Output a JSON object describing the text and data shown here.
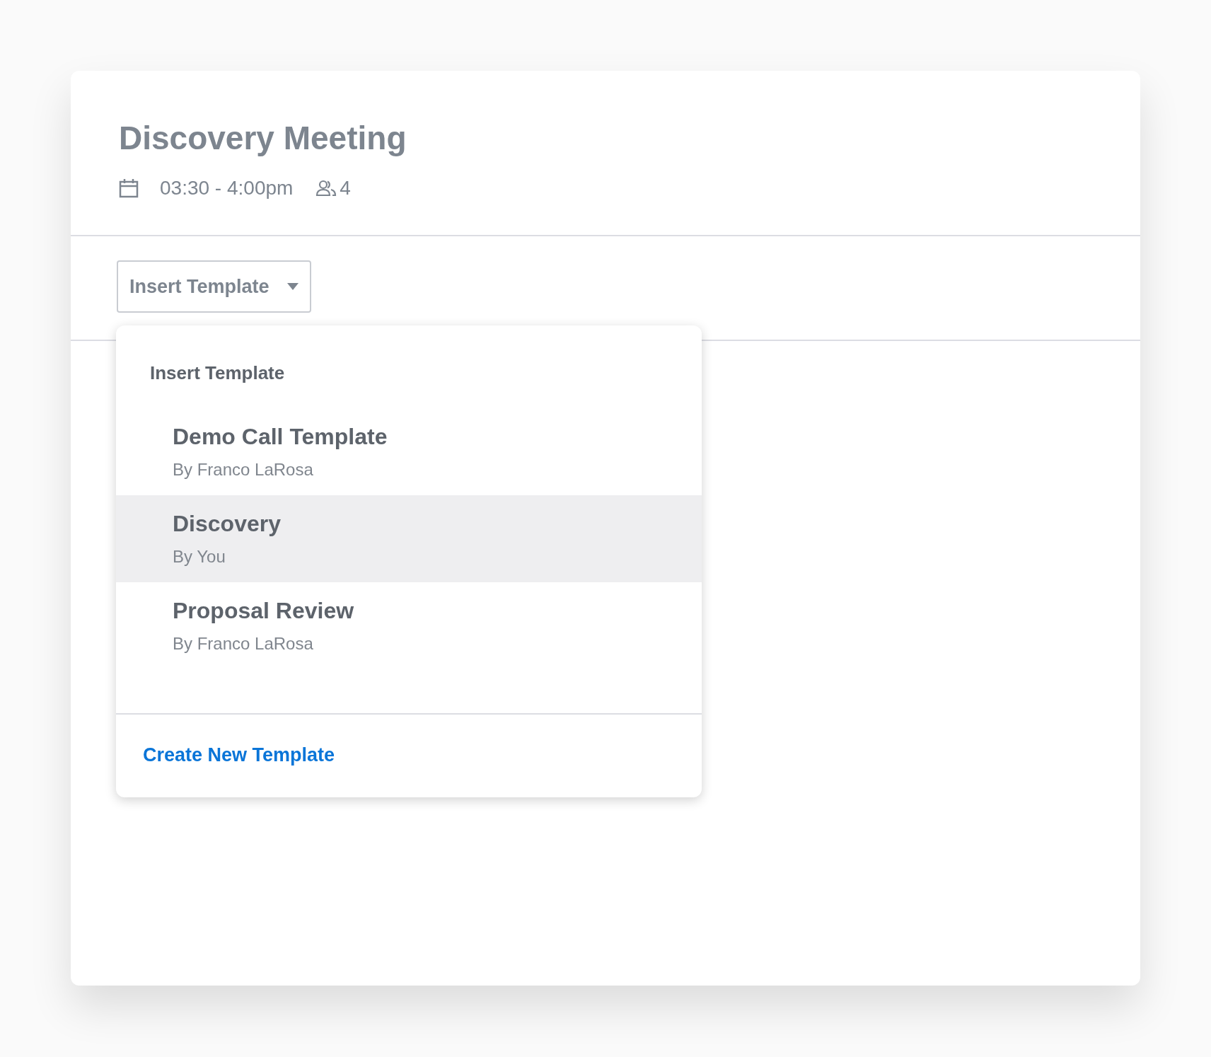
{
  "meeting": {
    "title": "Discovery Meeting",
    "time": "03:30 - 4:00pm",
    "attendees": "4"
  },
  "toolbar": {
    "dropdown_label": "Insert Template",
    "expanded": true
  },
  "menu": {
    "heading": "Insert Template",
    "items": [
      {
        "name": "Demo Call Template",
        "author": "By Franco LaRosa",
        "selected": false
      },
      {
        "name": "Discovery",
        "author": "By You",
        "selected": true
      },
      {
        "name": "Proposal Review",
        "author": "By Franco LaRosa",
        "selected": false
      }
    ],
    "footer_link": "Create New Template"
  }
}
